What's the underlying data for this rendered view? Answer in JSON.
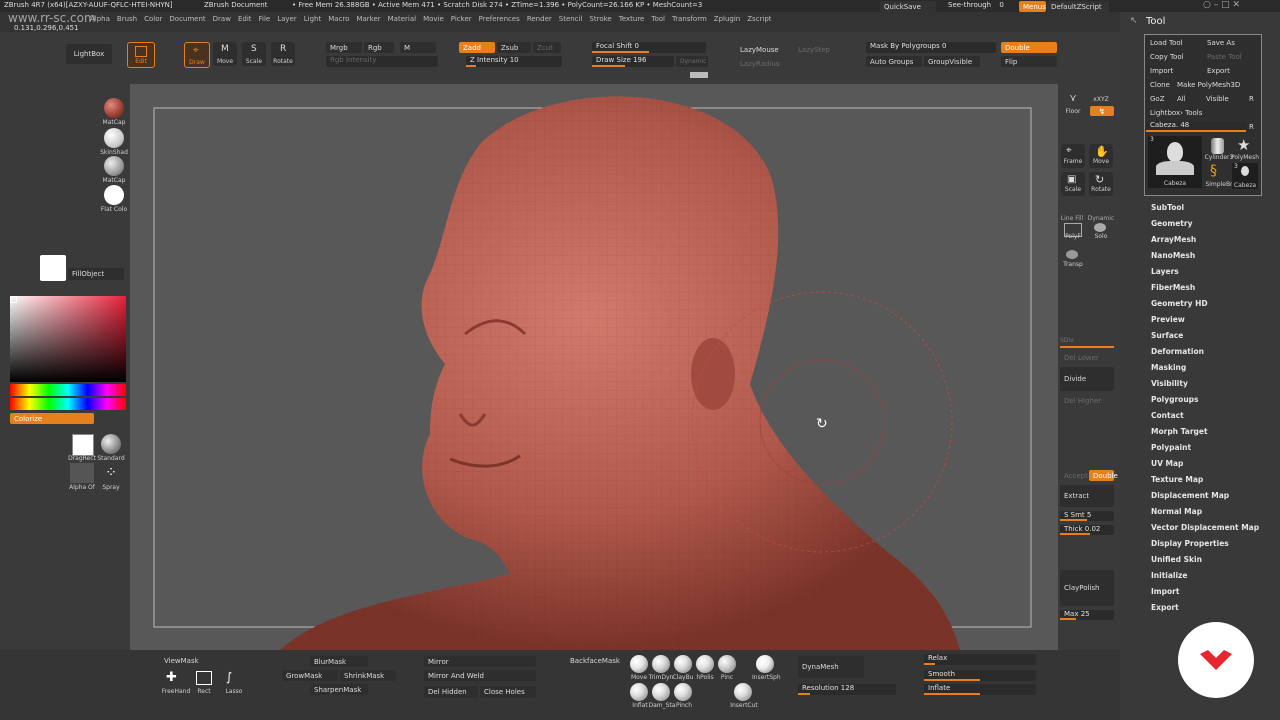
{
  "titlebar": {
    "app": "ZBrush 4R7 (x64)[AZXY-AUUF-QFLC-HTEI-NHYN]",
    "document": "ZBrush Document",
    "stats": "• Free Mem 26.388GB • Active Mem 471 • Scratch Disk 274 • ZTime=1.396 • PolyCount=26.166 KP • MeshCount=3",
    "quicksave": "QuickSave",
    "see_through": "See-through",
    "see_through_value": "0",
    "menus": "Menus",
    "default_script": "DefaultZScript"
  },
  "coords": "0.131,0.296,0.451",
  "watermark": "www.rr-sc.com",
  "menus": [
    "Alpha",
    "Brush",
    "Color",
    "Document",
    "Draw",
    "Edit",
    "File",
    "Layer",
    "Light",
    "Macro",
    "Marker",
    "Material",
    "Movie",
    "Picker",
    "Preferences",
    "Render",
    "Stencil",
    "Stroke",
    "Texture",
    "Tool",
    "Transform",
    "Zplugin",
    "Zscript"
  ],
  "toolbar": {
    "lightbox": "LightBox",
    "edit": "Edit",
    "draw": "Draw",
    "move": "Move",
    "scale": "Scale",
    "rotate": "Rotate",
    "mrgb": "Mrgb",
    "rgb": "Rgb",
    "m": "M",
    "rgb_intensity": "Rgb Intensity",
    "zadd": "Zadd",
    "zsub": "Zsub",
    "zcut": "Zcut",
    "z_intensity": "Z Intensity 10",
    "focal_shift": "Focal Shift 0",
    "draw_size": "Draw Size 196",
    "dynamic": "Dynamic",
    "lazymouse": "LazyMouse",
    "lazystep": "LazyStep",
    "lazyradius": "LazyRadius",
    "mask_by_polygroups": "Mask By Polygroups 0",
    "auto_groups": "Auto Groups",
    "group_visible": "GroupVisible",
    "double": "Double",
    "flip": "Flip"
  },
  "left_shelf": {
    "matcap1": "MatCap",
    "skinshade": "SkinShad",
    "matcap2": "MatCap",
    "flat_color": "Flat Colo",
    "fill_object": "FillObject",
    "colorize": "Colorize",
    "dragrect": "DragRect",
    "standard": "Standard",
    "alpha_off": "Alpha Of",
    "spray": "Spray"
  },
  "right_shelf": {
    "floor": "Floor",
    "xyz": "xXYZ",
    "frame": "Frame",
    "move": "Move",
    "scale": "Scale",
    "rotate": "Rotate",
    "polyf": "PolyF",
    "line_fill": "Line Fill",
    "solo": "Solo",
    "dynamic": "Dynamic",
    "transp": "Transp",
    "sdiv": "SDiv",
    "del_lower": "Del Lower",
    "divide": "Divide",
    "del_higher": "Del Higher",
    "accept": "Accept",
    "double": "Double",
    "extract": "Extract",
    "smt": "S Smt 5",
    "thick": "Thick 0.02",
    "claypolish": "ClayPolish",
    "max": "Max 25"
  },
  "tool_tray": {
    "title": "Tool",
    "load_tool": "Load Tool",
    "save_as": "Save As",
    "copy_tool": "Copy Tool",
    "paste_tool": "Paste Tool",
    "import": "Import",
    "export": "Export",
    "clone": "Clone",
    "make_polymesh": "Make PolyMesh3D",
    "goz": "GoZ",
    "all": "All",
    "visible": "Visible",
    "r": "R",
    "lightbox_tools": "Lightbox› Tools",
    "current_tool": "Cabeza. 48",
    "thumbs": [
      "Cabeza",
      "Cylinder3",
      "PolyMesh",
      "SimpleBr",
      "Cabeza"
    ],
    "thumb_counts": [
      "3",
      "3"
    ],
    "items": [
      "SubTool",
      "Geometry",
      "ArrayMesh",
      "NanoMesh",
      "Layers",
      "FiberMesh",
      "Geometry HD",
      "Preview",
      "Surface",
      "Deformation",
      "Masking",
      "Visibility",
      "Polygroups",
      "Contact",
      "Morph Target",
      "Polypaint",
      "UV Map",
      "Texture Map",
      "Displacement Map",
      "Normal Map",
      "Vector Displacement Map",
      "Display Properties",
      "Unified Skin",
      "Initialize",
      "Import",
      "Export"
    ]
  },
  "bottom": {
    "viewmask": "ViewMask",
    "freehand": "FreeHand",
    "rect": "Rect",
    "lasso": "Lasso",
    "blurmask": "BlurMask",
    "growmask": "GrowMask",
    "shrinkmask": "ShrinkMask",
    "sharpenmask": "SharpenMask",
    "mirror": "Mirror",
    "mirror_weld": "Mirror And Weld",
    "del_hidden": "Del Hidden",
    "close_holes": "Close Holes",
    "backface_mask": "BackfaceMask",
    "brushes": [
      "Move",
      "TrimDyn",
      "ClayBu",
      "hPolis",
      "Pinc",
      "InsertSph"
    ],
    "brushes2": [
      "Inflat",
      "Dam_Sta",
      "Pinch",
      "InsertCut"
    ],
    "dynamesh": "DynaMesh",
    "resolution": "Resolution 128",
    "relax": "Relax",
    "smooth": "Smooth",
    "inflate": "Inflate"
  },
  "colors": {
    "accent": "#e6801c",
    "clay": "#b5564a",
    "canvas": "#585858"
  }
}
